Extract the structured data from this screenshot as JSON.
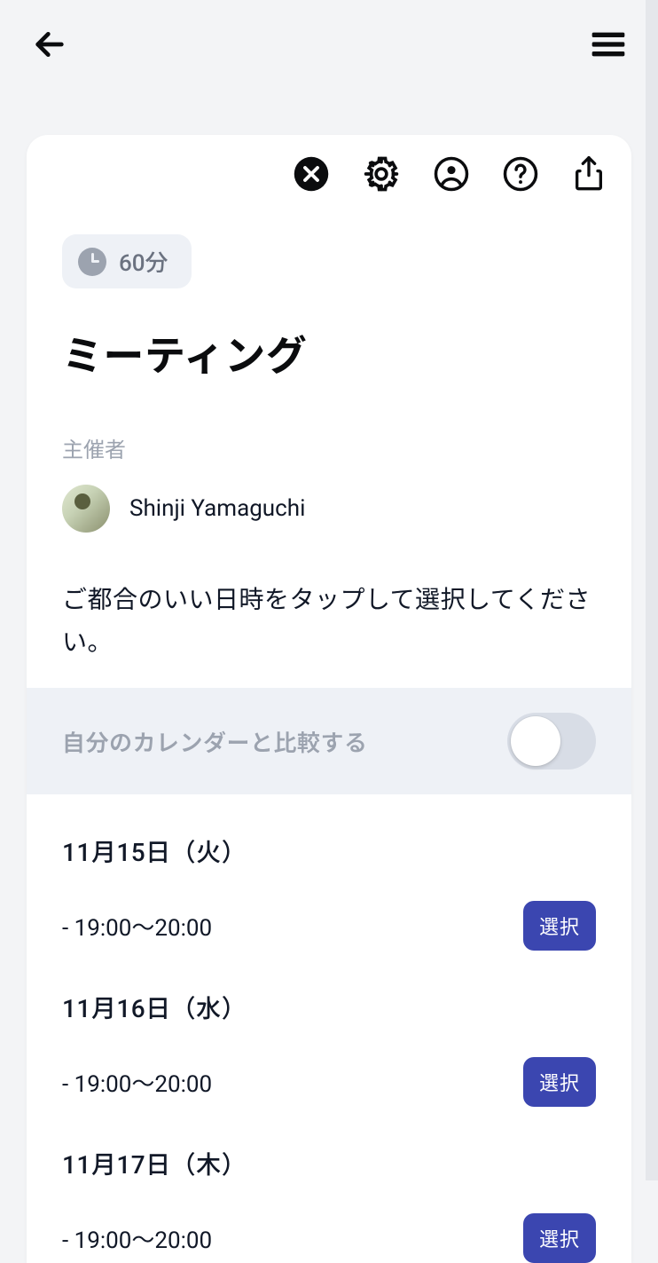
{
  "header": {
    "back_icon": "arrow-left",
    "menu_icon": "hamburger"
  },
  "toolbar": {
    "close_icon": "close",
    "settings_icon": "gear",
    "account_icon": "account-circle",
    "help_icon": "help-circle",
    "share_icon": "share"
  },
  "meeting": {
    "duration_label": "60分",
    "title": "ミーティング",
    "host_label": "主催者",
    "host_name": "Shinji Yamaguchi",
    "instruction": "ご都合のいい日時をタップして選択してください。"
  },
  "compare": {
    "label": "自分のカレンダーと比較する",
    "enabled": false
  },
  "slots": [
    {
      "date": "11月15日（火）",
      "time": "- 19:00〜20:00",
      "button": "選択"
    },
    {
      "date": "11月16日（水）",
      "time": "- 19:00〜20:00",
      "button": "選択"
    },
    {
      "date": "11月17日（木）",
      "time": "- 19:00〜20:00",
      "button": "選択"
    }
  ]
}
